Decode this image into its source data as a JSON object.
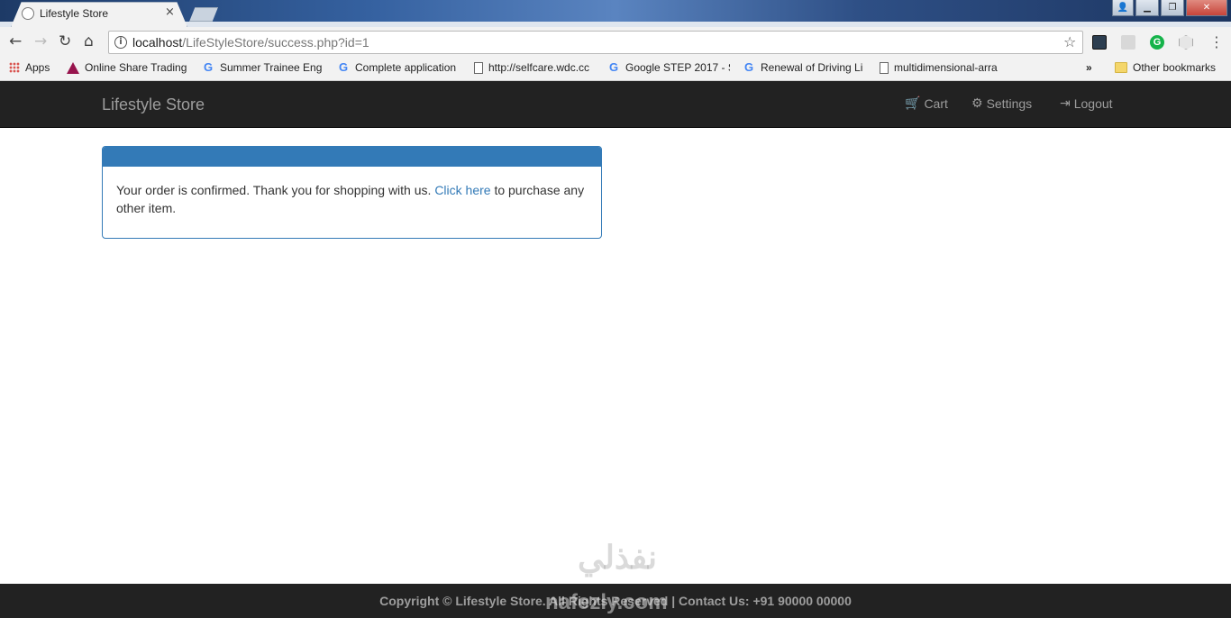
{
  "browser": {
    "tab_title": "Lifestyle Store",
    "tab_close": "×",
    "url_host": "localhost",
    "url_path": "/LifeStyleStore/success.php?id=1",
    "window_controls": {
      "minimize": "▁",
      "restore": "❐",
      "close": "✕"
    },
    "extension_grammarly": "G"
  },
  "bookmarks": {
    "items": [
      {
        "label": "Apps",
        "icon": "apps-grid-icon"
      },
      {
        "label": "Online Share Trading",
        "icon": "axis-bank-icon"
      },
      {
        "label": "Summer Trainee Eng",
        "icon": "google-icon"
      },
      {
        "label": "Complete application",
        "icon": "google-icon"
      },
      {
        "label": "http://selfcare.wdc.cc",
        "icon": "page-icon"
      },
      {
        "label": "Google STEP 2017 - S",
        "icon": "google-icon"
      },
      {
        "label": "Renewal of Driving Li",
        "icon": "google-icon"
      },
      {
        "label": "multidimensional-arra",
        "icon": "page-icon"
      }
    ],
    "overflow": "»",
    "other": "Other bookmarks"
  },
  "site": {
    "brand": "Lifestyle Store",
    "nav": {
      "cart": "Cart",
      "settings": "Settings",
      "logout": "Logout"
    }
  },
  "panel": {
    "message_before": "Your order is confirmed. Thank you for shopping with us. ",
    "link_text": "Click here",
    "message_after": " to purchase any other item."
  },
  "footer": {
    "text": "Copyright © Lifestyle Store. All Rights Reserved | Contact Us: +91 90000 00000"
  },
  "watermark": {
    "arabic": "نفذلي",
    "latin": "nafezly.com"
  },
  "colors": {
    "navbar_bg": "#222222",
    "panel_primary": "#337ab7",
    "link": "#337ab7"
  }
}
